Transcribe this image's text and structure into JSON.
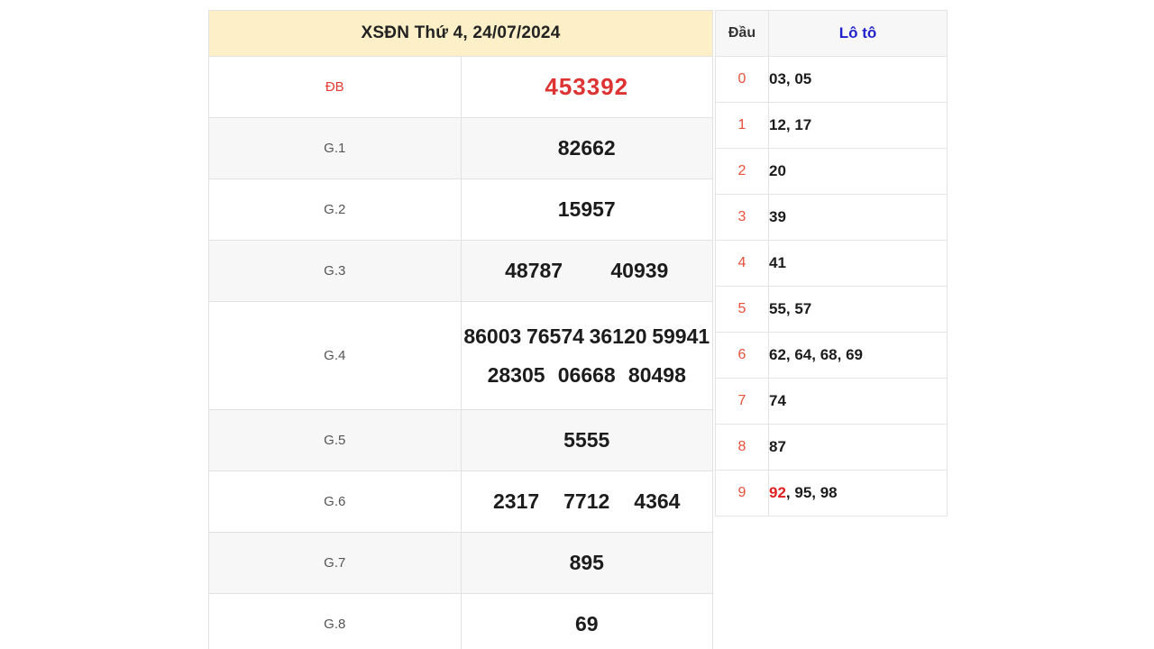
{
  "result_table": {
    "title": "XSĐN Thứ 4, 24/07/2024",
    "rows": [
      {
        "label": "ĐB",
        "numbers": [
          "453392"
        ]
      },
      {
        "label": "G.1",
        "numbers": [
          "82662"
        ]
      },
      {
        "label": "G.2",
        "numbers": [
          "15957"
        ]
      },
      {
        "label": "G.3",
        "numbers": [
          "48787",
          "40939"
        ]
      },
      {
        "label": "G.4",
        "numbers": [
          "86003",
          "76574",
          "36120",
          "59941",
          "28305",
          "06668",
          "80498"
        ]
      },
      {
        "label": "G.5",
        "numbers": [
          "5555"
        ]
      },
      {
        "label": "G.6",
        "numbers": [
          "2317",
          "7712",
          "4364"
        ]
      },
      {
        "label": "G.7",
        "numbers": [
          "895"
        ]
      },
      {
        "label": "G.8",
        "numbers": [
          "69"
        ]
      }
    ]
  },
  "loto_table": {
    "header": {
      "dau": "Đầu",
      "loto": "Lô tô"
    },
    "rows": [
      {
        "dau": "0",
        "loto": "03, 05",
        "highlight": ""
      },
      {
        "dau": "1",
        "loto": "12, 17",
        "highlight": ""
      },
      {
        "dau": "2",
        "loto": "20",
        "highlight": ""
      },
      {
        "dau": "3",
        "loto": "39",
        "highlight": ""
      },
      {
        "dau": "4",
        "loto": "41",
        "highlight": ""
      },
      {
        "dau": "5",
        "loto": "55, 57",
        "highlight": ""
      },
      {
        "dau": "6",
        "loto": "62, 64, 68, 69",
        "highlight": ""
      },
      {
        "dau": "7",
        "loto": "74",
        "highlight": ""
      },
      {
        "dau": "8",
        "loto": "87",
        "highlight": ""
      },
      {
        "dau": "9",
        "loto": ", 95, 98",
        "highlight": "92"
      }
    ]
  },
  "colors": {
    "header_bg": "#fdf0c8",
    "special_red": "#dd3333",
    "loto_blue": "#2222cc",
    "dau_orange": "#e8503a",
    "highlight_red": "#e02020"
  }
}
